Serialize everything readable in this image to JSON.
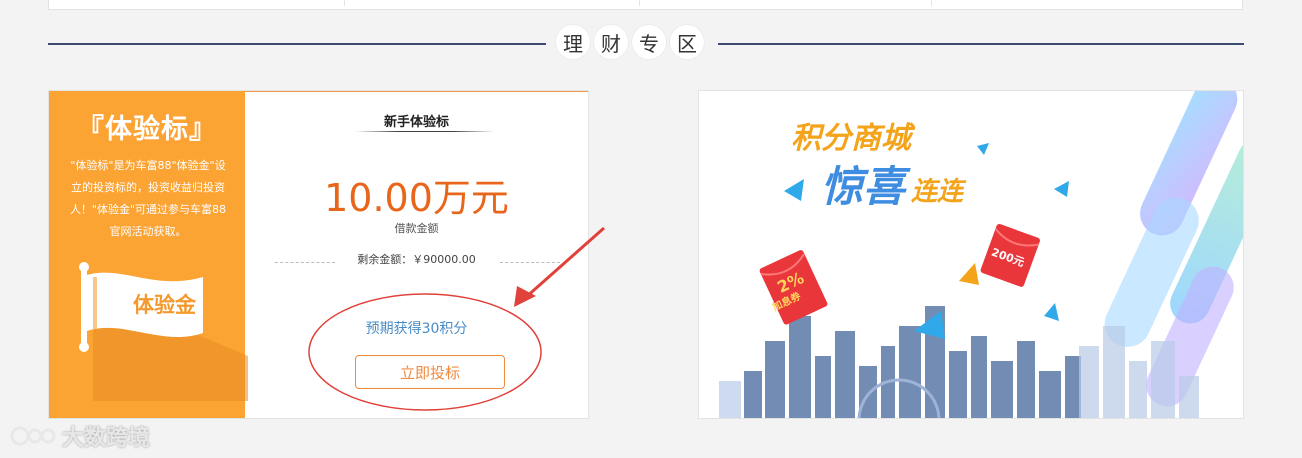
{
  "section": {
    "title_chars": [
      "理",
      "财",
      "专",
      "区"
    ]
  },
  "trial_card": {
    "badge_title": "『体验标』",
    "description": "\"体验标\"是为车富88\"体验金\"设立的投资标的，投资收益归投资人！\"体验金\"可通过参与车富88官网活动获取。",
    "flag_label": "体验金",
    "product_title": "新手体验标",
    "amount": "10.00万元",
    "amount_label": "借款金额",
    "remaining": "剩余金额：￥90000.00",
    "expected_points": "预期获得30积分",
    "invest_button": "立即投标"
  },
  "promo_banner": {
    "title": "积分商城",
    "subtitle_main": "惊喜",
    "subtitle_tail": "连连",
    "envelope_left_value": "2%",
    "envelope_left_sub": "加息券",
    "envelope_right_value": "200元"
  },
  "watermark": {
    "text": "大数跨境"
  },
  "colors": {
    "accent_orange": "#fba333",
    "link_blue": "#4a8cc7",
    "section_line": "#3d4a72",
    "annotation_red": "#e0413a"
  }
}
